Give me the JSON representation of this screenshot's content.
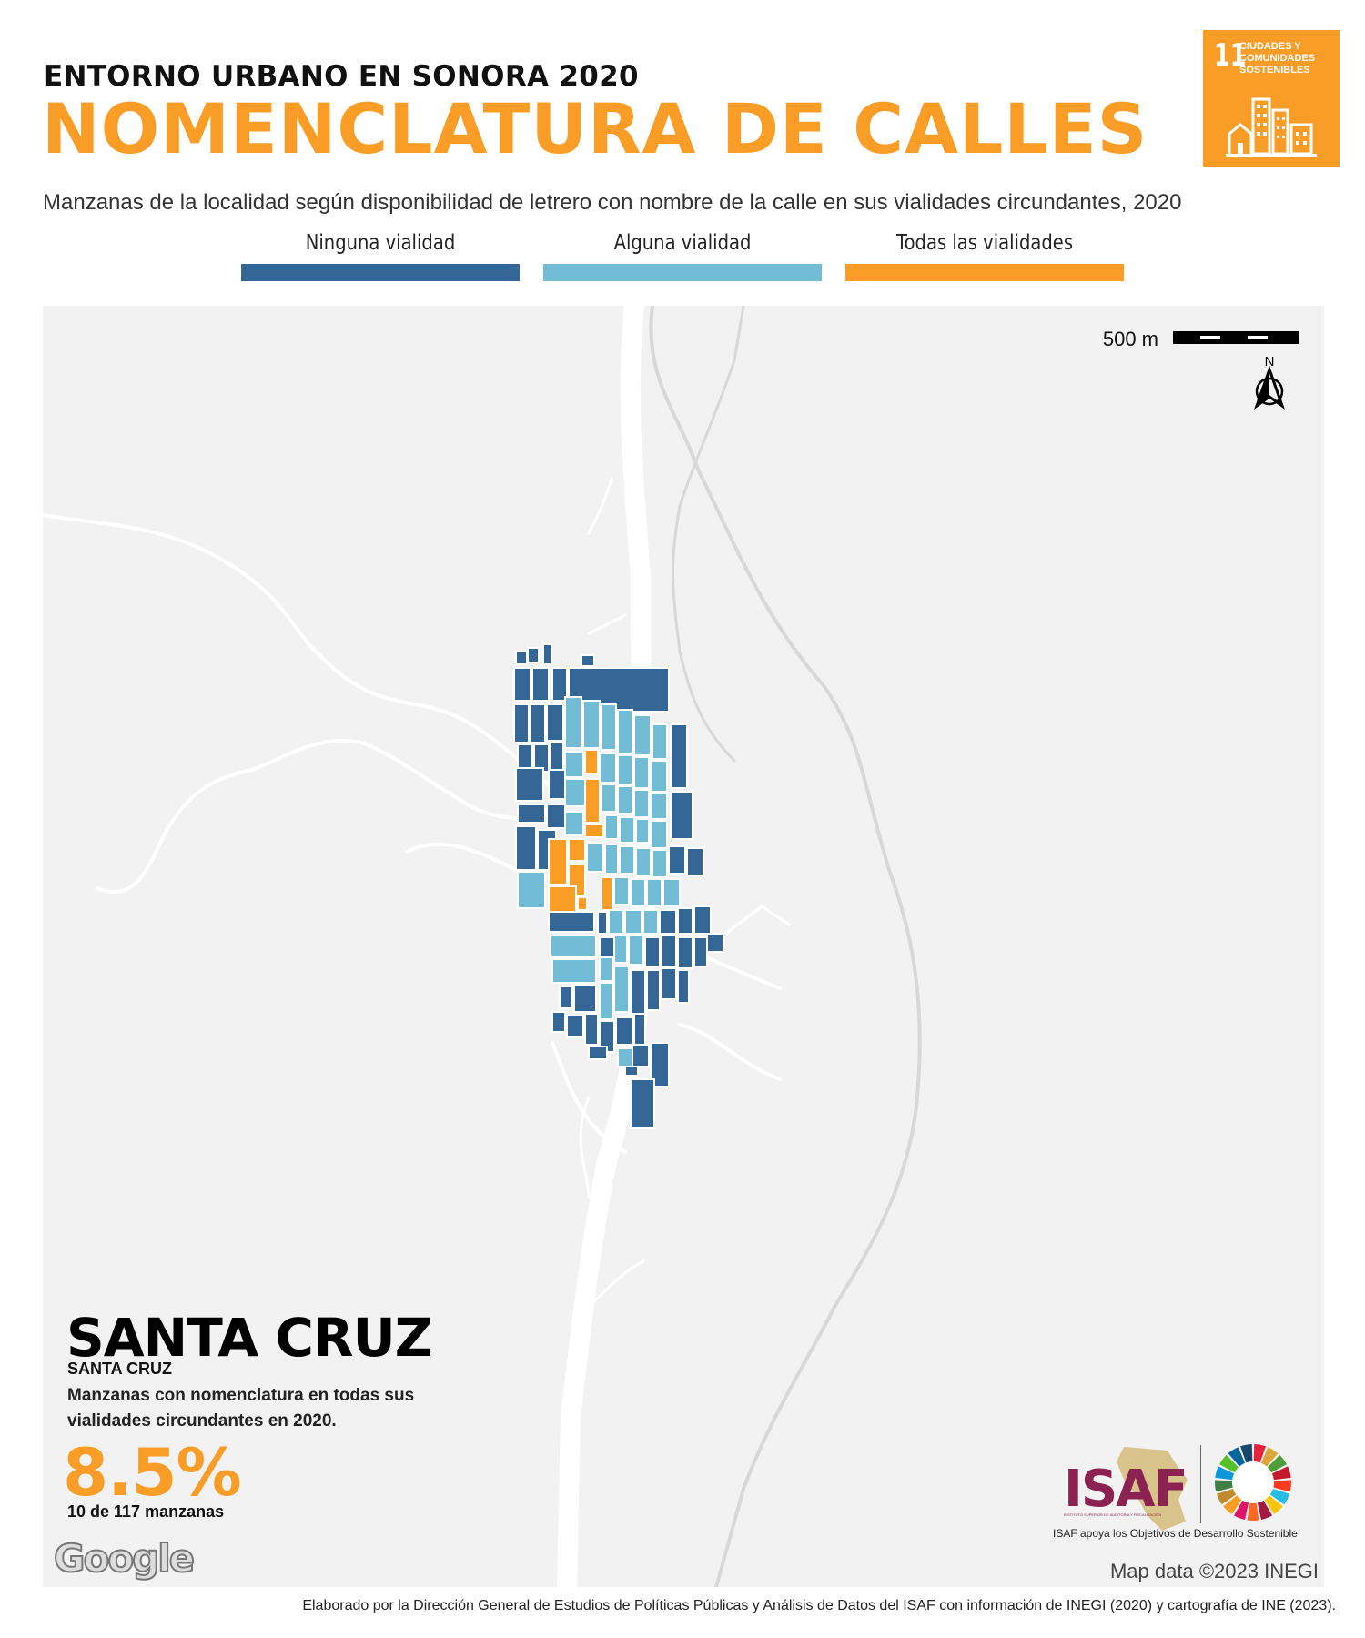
{
  "header": {
    "supertitle": "ENTORNO URBANO EN SONORA 2020",
    "title": "NOMENCLATURA DE CALLES",
    "subtitle": "Manzanas de la localidad según disponibilidad de letrero con nombre de la calle en sus vialidades circundantes, 2020"
  },
  "sdg_badge": {
    "number": "11",
    "text": "CIUDADES Y COMUNIDADES SOSTENIBLES",
    "color": "#F99D26"
  },
  "legend": [
    {
      "label": "Ninguna vialidad",
      "color": "#356796"
    },
    {
      "label": "Alguna vialidad",
      "color": "#72BCD6"
    },
    {
      "label": "Todas las vialidades",
      "color": "#F99D26"
    }
  ],
  "map": {
    "scale_label": "500 m",
    "north_label": "N",
    "attribution": "Map data ©2023 INEGI",
    "basemap_logo": "Google",
    "background_color": "#f2f2f2",
    "road_color": "#ffffff"
  },
  "place": {
    "locality": "SANTA CRUZ",
    "municipality": "SANTA CRUZ"
  },
  "indicator": {
    "description": "Manzanas con nomenclatura en todas sus vialidades circundantes en 2020.",
    "value": "8.5%",
    "count": "10 de 117 manzanas",
    "value_color": "#F99D26"
  },
  "logos": {
    "isaf": "ISAF",
    "isaf_small": "INSTITUTO SUPERIOR DE AUDITORÍA Y FISCALIZACIÓN",
    "caption": "ISAF apoya los Objetivos de Desarrollo Sostenible"
  },
  "footer": "Elaborado por la Dirección General de Estudios de Políticas Públicas y Análisis de Datos del ISAF con información de INEGI (2020) y cartografía de INE (2023)."
}
